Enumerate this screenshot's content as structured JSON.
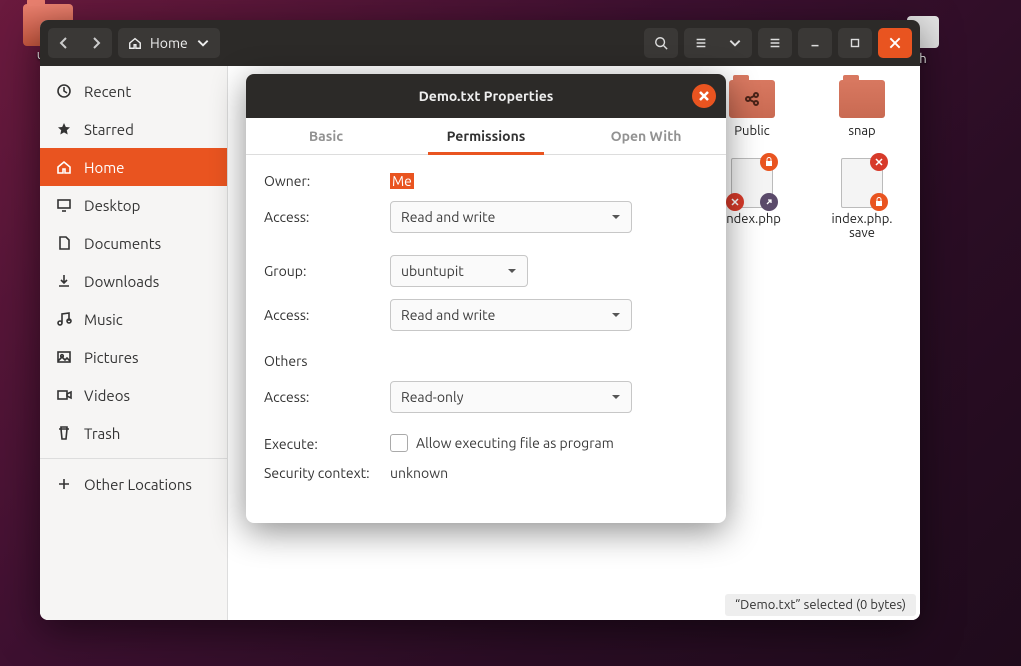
{
  "desktop": {
    "left_label": "ubu",
    "right_label": "h"
  },
  "toolbar": {
    "path_label": "Home"
  },
  "sidebar": {
    "items": [
      {
        "id": "recent",
        "label": "Recent"
      },
      {
        "id": "starred",
        "label": "Starred"
      },
      {
        "id": "home",
        "label": "Home"
      },
      {
        "id": "desktop",
        "label": "Desktop"
      },
      {
        "id": "documents",
        "label": "Documents"
      },
      {
        "id": "downloads",
        "label": "Downloads"
      },
      {
        "id": "music",
        "label": "Music"
      },
      {
        "id": "pictures",
        "label": "Pictures"
      },
      {
        "id": "videos",
        "label": "Videos"
      },
      {
        "id": "trash",
        "label": "Trash"
      }
    ],
    "other_locations": "Other Locations"
  },
  "files": {
    "public": "Public",
    "snap": "snap",
    "index_php": "index.php",
    "index_php_save": "index.php.\nsave"
  },
  "statusbar": "“Demo.txt” selected  (0 bytes)",
  "dialog": {
    "title": "Demo.txt Properties",
    "tabs": {
      "basic": "Basic",
      "permissions": "Permissions",
      "open_with": "Open With"
    },
    "labels": {
      "owner": "Owner:",
      "access": "Access:",
      "group": "Group:",
      "others": "Others",
      "execute": "Execute:",
      "security": "Security context:"
    },
    "values": {
      "owner": "Me",
      "owner_access": "Read and write",
      "group": "ubuntupit",
      "group_access": "Read and write",
      "others_access": "Read-only",
      "execute_label": "Allow executing file as program",
      "security": "unknown"
    }
  }
}
